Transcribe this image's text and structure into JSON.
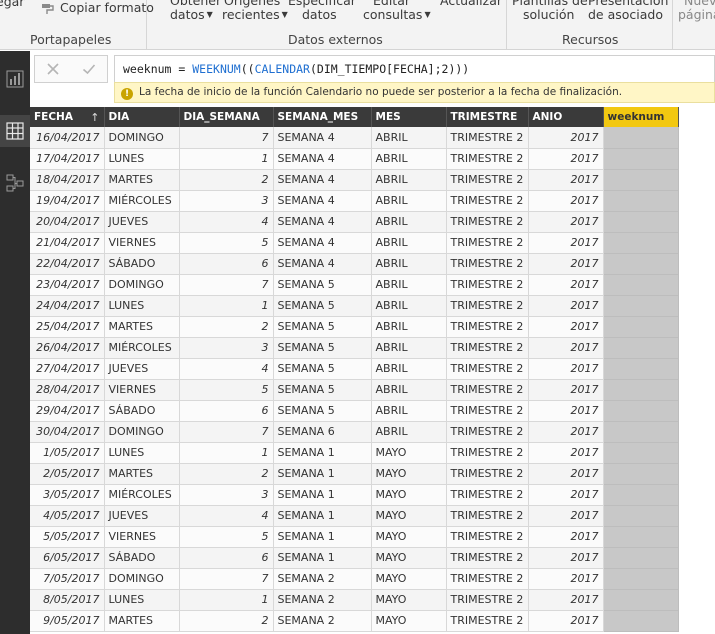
{
  "ribbon": {
    "paste_partial": "egar",
    "copy_format": "Copiar formato",
    "obtener_l1": "Obtener",
    "obtener_l2": "datos",
    "origenes_l1": "Orígenes",
    "origenes_l2": "recientes",
    "especificar_l1": "Especificar",
    "especificar_l2": "datos",
    "editar_l1": "Editar",
    "editar_l2": "consultas",
    "actualizar": "Actualizar",
    "plantillas_l1": "Plantillas de",
    "plantillas_l2": "solución",
    "presentacion_l1": "Presentación",
    "presentacion_l2": "de asociado",
    "nueva_l1": "Nueva",
    "nueva_l2": "página",
    "groups": {
      "portapapeles": "Portapapeles",
      "datos_externos": "Datos externos",
      "recursos": "Recursos"
    }
  },
  "nav": {
    "icons": [
      "report-view-icon",
      "data-view-icon",
      "relationships-view-icon"
    ]
  },
  "formula": {
    "prefix": "weeknum = ",
    "fn1": "WEEKNUM",
    "mid": "((",
    "fn2": "CALENDAR",
    "suffix": "(DIM_TIEMPO[FECHA];2)))",
    "warning": "La fecha de inicio de la función Calendario no puede ser posterior a la fecha de finalización."
  },
  "table": {
    "columns": [
      "FECHA",
      "DIA",
      "DIA_SEMANA",
      "SEMANA_MES",
      "MES",
      "TRIMESTRE",
      "ANIO",
      "weeknum"
    ],
    "sort_indicator": "↑",
    "rows": [
      [
        "16/04/2017",
        "DOMINGO",
        "7",
        "SEMANA 4",
        "ABRIL",
        "TRIMESTRE 2",
        "2017"
      ],
      [
        "17/04/2017",
        "LUNES",
        "1",
        "SEMANA 4",
        "ABRIL",
        "TRIMESTRE 2",
        "2017"
      ],
      [
        "18/04/2017",
        "MARTES",
        "2",
        "SEMANA 4",
        "ABRIL",
        "TRIMESTRE 2",
        "2017"
      ],
      [
        "19/04/2017",
        "MIÉRCOLES",
        "3",
        "SEMANA 4",
        "ABRIL",
        "TRIMESTRE 2",
        "2017"
      ],
      [
        "20/04/2017",
        "JUEVES",
        "4",
        "SEMANA 4",
        "ABRIL",
        "TRIMESTRE 2",
        "2017"
      ],
      [
        "21/04/2017",
        "VIERNES",
        "5",
        "SEMANA 4",
        "ABRIL",
        "TRIMESTRE 2",
        "2017"
      ],
      [
        "22/04/2017",
        "SÁBADO",
        "6",
        "SEMANA 4",
        "ABRIL",
        "TRIMESTRE 2",
        "2017"
      ],
      [
        "23/04/2017",
        "DOMINGO",
        "7",
        "SEMANA 5",
        "ABRIL",
        "TRIMESTRE 2",
        "2017"
      ],
      [
        "24/04/2017",
        "LUNES",
        "1",
        "SEMANA 5",
        "ABRIL",
        "TRIMESTRE 2",
        "2017"
      ],
      [
        "25/04/2017",
        "MARTES",
        "2",
        "SEMANA 5",
        "ABRIL",
        "TRIMESTRE 2",
        "2017"
      ],
      [
        "26/04/2017",
        "MIÉRCOLES",
        "3",
        "SEMANA 5",
        "ABRIL",
        "TRIMESTRE 2",
        "2017"
      ],
      [
        "27/04/2017",
        "JUEVES",
        "4",
        "SEMANA 5",
        "ABRIL",
        "TRIMESTRE 2",
        "2017"
      ],
      [
        "28/04/2017",
        "VIERNES",
        "5",
        "SEMANA 5",
        "ABRIL",
        "TRIMESTRE 2",
        "2017"
      ],
      [
        "29/04/2017",
        "SÁBADO",
        "6",
        "SEMANA 5",
        "ABRIL",
        "TRIMESTRE 2",
        "2017"
      ],
      [
        "30/04/2017",
        "DOMINGO",
        "7",
        "SEMANA 6",
        "ABRIL",
        "TRIMESTRE 2",
        "2017"
      ],
      [
        "1/05/2017",
        "LUNES",
        "1",
        "SEMANA 1",
        "MAYO",
        "TRIMESTRE 2",
        "2017"
      ],
      [
        "2/05/2017",
        "MARTES",
        "2",
        "SEMANA 1",
        "MAYO",
        "TRIMESTRE 2",
        "2017"
      ],
      [
        "3/05/2017",
        "MIÉRCOLES",
        "3",
        "SEMANA 1",
        "MAYO",
        "TRIMESTRE 2",
        "2017"
      ],
      [
        "4/05/2017",
        "JUEVES",
        "4",
        "SEMANA 1",
        "MAYO",
        "TRIMESTRE 2",
        "2017"
      ],
      [
        "5/05/2017",
        "VIERNES",
        "5",
        "SEMANA 1",
        "MAYO",
        "TRIMESTRE 2",
        "2017"
      ],
      [
        "6/05/2017",
        "SÁBADO",
        "6",
        "SEMANA 1",
        "MAYO",
        "TRIMESTRE 2",
        "2017"
      ],
      [
        "7/05/2017",
        "DOMINGO",
        "7",
        "SEMANA 2",
        "MAYO",
        "TRIMESTRE 2",
        "2017"
      ],
      [
        "8/05/2017",
        "LUNES",
        "1",
        "SEMANA 2",
        "MAYO",
        "TRIMESTRE 2",
        "2017"
      ],
      [
        "9/05/2017",
        "MARTES",
        "2",
        "SEMANA 2",
        "MAYO",
        "TRIMESTRE 2",
        "2017"
      ]
    ]
  }
}
